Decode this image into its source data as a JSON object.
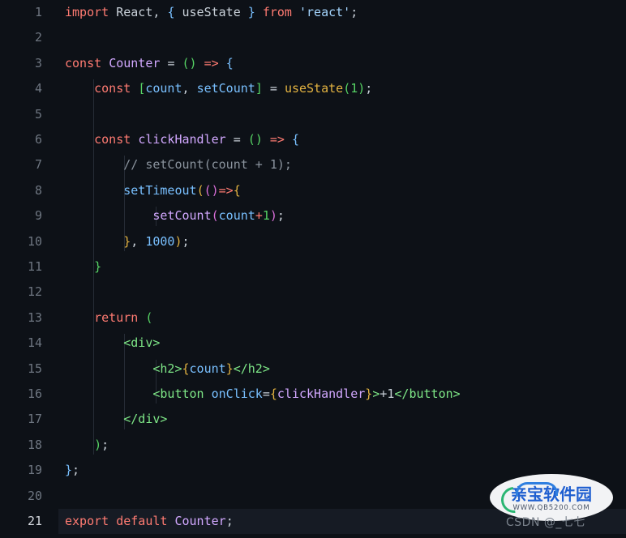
{
  "editor": {
    "theme": "dark-plus",
    "background": "#0d1117",
    "active_line_background": "#161b24",
    "gutter_color": "#6e7681",
    "active_gutter_color": "#d4d8de",
    "active_line": 21,
    "total_lines": 21,
    "language": "javascript-react"
  },
  "lines": [
    {
      "n": "1",
      "indent": 0,
      "tokens": [
        {
          "t": "import",
          "c": "kw"
        },
        {
          "t": " ",
          "c": "var"
        },
        {
          "t": "React",
          "c": "var"
        },
        {
          "t": ", ",
          "c": "var"
        },
        {
          "t": "{",
          "c": "b2"
        },
        {
          "t": " ",
          "c": "var"
        },
        {
          "t": "useState",
          "c": "var"
        },
        {
          "t": " ",
          "c": "var"
        },
        {
          "t": "}",
          "c": "b2"
        },
        {
          "t": " ",
          "c": "var"
        },
        {
          "t": "from",
          "c": "kw"
        },
        {
          "t": " ",
          "c": "var"
        },
        {
          "t": "'react'",
          "c": "str"
        },
        {
          "t": ";",
          "c": "var"
        }
      ]
    },
    {
      "n": "2",
      "indent": 0,
      "tokens": []
    },
    {
      "n": "3",
      "indent": 0,
      "tokens": [
        {
          "t": "const",
          "c": "kw"
        },
        {
          "t": " ",
          "c": "var"
        },
        {
          "t": "Counter",
          "c": "fn"
        },
        {
          "t": " ",
          "c": "var"
        },
        {
          "t": "=",
          "c": "var"
        },
        {
          "t": " ",
          "c": "var"
        },
        {
          "t": "(",
          "c": "b1"
        },
        {
          "t": ")",
          "c": "b1"
        },
        {
          "t": " ",
          "c": "var"
        },
        {
          "t": "=>",
          "c": "kw"
        },
        {
          "t": " ",
          "c": "var"
        },
        {
          "t": "{",
          "c": "b2"
        }
      ]
    },
    {
      "n": "4",
      "indent": 1,
      "tokens": [
        {
          "t": "    ",
          "c": "var"
        },
        {
          "t": "const",
          "c": "kw"
        },
        {
          "t": " ",
          "c": "var"
        },
        {
          "t": "[",
          "c": "b1"
        },
        {
          "t": "count",
          "c": "call"
        },
        {
          "t": ", ",
          "c": "var"
        },
        {
          "t": "setCount",
          "c": "call"
        },
        {
          "t": "]",
          "c": "b1"
        },
        {
          "t": " ",
          "c": "var"
        },
        {
          "t": "=",
          "c": "var"
        },
        {
          "t": " ",
          "c": "var"
        },
        {
          "t": "useState",
          "c": "yel"
        },
        {
          "t": "(",
          "c": "b1"
        },
        {
          "t": "1",
          "c": "num2"
        },
        {
          "t": ")",
          "c": "b1"
        },
        {
          "t": ";",
          "c": "var"
        }
      ]
    },
    {
      "n": "5",
      "indent": 1,
      "tokens": []
    },
    {
      "n": "6",
      "indent": 1,
      "tokens": [
        {
          "t": "    ",
          "c": "var"
        },
        {
          "t": "const",
          "c": "kw"
        },
        {
          "t": " ",
          "c": "var"
        },
        {
          "t": "clickHandler",
          "c": "fn"
        },
        {
          "t": " ",
          "c": "var"
        },
        {
          "t": "=",
          "c": "var"
        },
        {
          "t": " ",
          "c": "var"
        },
        {
          "t": "(",
          "c": "b1"
        },
        {
          "t": ")",
          "c": "b1"
        },
        {
          "t": " ",
          "c": "var"
        },
        {
          "t": "=>",
          "c": "kw"
        },
        {
          "t": " ",
          "c": "var"
        },
        {
          "t": "{",
          "c": "b2"
        }
      ]
    },
    {
      "n": "7",
      "indent": 2,
      "tokens": [
        {
          "t": "        ",
          "c": "var"
        },
        {
          "t": "// setCount(count + 1);",
          "c": "cmt"
        }
      ]
    },
    {
      "n": "8",
      "indent": 2,
      "tokens": [
        {
          "t": "        ",
          "c": "var"
        },
        {
          "t": "setTimeout",
          "c": "call"
        },
        {
          "t": "(",
          "c": "b3"
        },
        {
          "t": "(",
          "c": "b4"
        },
        {
          "t": ")",
          "c": "b4"
        },
        {
          "t": "=>",
          "c": "kw"
        },
        {
          "t": "{",
          "c": "b3"
        }
      ]
    },
    {
      "n": "9",
      "indent": 3,
      "tokens": [
        {
          "t": "            ",
          "c": "var"
        },
        {
          "t": "setCount",
          "c": "fn"
        },
        {
          "t": "(",
          "c": "b4"
        },
        {
          "t": "count",
          "c": "call"
        },
        {
          "t": "+",
          "c": "kw"
        },
        {
          "t": "1",
          "c": "num2"
        },
        {
          "t": ")",
          "c": "b4"
        },
        {
          "t": ";",
          "c": "var"
        }
      ]
    },
    {
      "n": "10",
      "indent": 2,
      "tokens": [
        {
          "t": "        ",
          "c": "var"
        },
        {
          "t": "}",
          "c": "b3"
        },
        {
          "t": ", ",
          "c": "var"
        },
        {
          "t": "1000",
          "c": "num"
        },
        {
          "t": ")",
          "c": "b3"
        },
        {
          "t": ";",
          "c": "var"
        }
      ]
    },
    {
      "n": "11",
      "indent": 1,
      "tokens": [
        {
          "t": "    ",
          "c": "var"
        },
        {
          "t": "}",
          "c": "b1"
        }
      ]
    },
    {
      "n": "12",
      "indent": 1,
      "tokens": []
    },
    {
      "n": "13",
      "indent": 1,
      "tokens": [
        {
          "t": "    ",
          "c": "var"
        },
        {
          "t": "return",
          "c": "kw"
        },
        {
          "t": " ",
          "c": "var"
        },
        {
          "t": "(",
          "c": "b1"
        }
      ]
    },
    {
      "n": "14",
      "indent": 2,
      "tokens": [
        {
          "t": "        ",
          "c": "var"
        },
        {
          "t": "<div>",
          "c": "tag"
        }
      ]
    },
    {
      "n": "15",
      "indent": 3,
      "tokens": [
        {
          "t": "            ",
          "c": "var"
        },
        {
          "t": "<h2>",
          "c": "tag"
        },
        {
          "t": "{",
          "c": "b3"
        },
        {
          "t": "count",
          "c": "call"
        },
        {
          "t": "}",
          "c": "b3"
        },
        {
          "t": "</h2>",
          "c": "tag"
        }
      ]
    },
    {
      "n": "16",
      "indent": 3,
      "tokens": [
        {
          "t": "            ",
          "c": "var"
        },
        {
          "t": "<button",
          "c": "tag"
        },
        {
          "t": " ",
          "c": "var"
        },
        {
          "t": "onClick",
          "c": "call"
        },
        {
          "t": "=",
          "c": "var"
        },
        {
          "t": "{",
          "c": "b3"
        },
        {
          "t": "clickHandler",
          "c": "fn"
        },
        {
          "t": "}",
          "c": "b3"
        },
        {
          "t": ">",
          "c": "tag"
        },
        {
          "t": "+1",
          "c": "var"
        },
        {
          "t": "</button>",
          "c": "tag"
        }
      ]
    },
    {
      "n": "17",
      "indent": 2,
      "tokens": [
        {
          "t": "        ",
          "c": "var"
        },
        {
          "t": "</div>",
          "c": "tag"
        }
      ]
    },
    {
      "n": "18",
      "indent": 1,
      "tokens": [
        {
          "t": "    ",
          "c": "var"
        },
        {
          "t": ")",
          "c": "b1"
        },
        {
          "t": ";",
          "c": "var"
        }
      ]
    },
    {
      "n": "19",
      "indent": 0,
      "tokens": [
        {
          "t": "}",
          "c": "b2"
        },
        {
          "t": ";",
          "c": "var"
        }
      ]
    },
    {
      "n": "20",
      "indent": 0,
      "tokens": []
    },
    {
      "n": "21",
      "indent": 0,
      "active": true,
      "tokens": [
        {
          "t": "export",
          "c": "kw"
        },
        {
          "t": " ",
          "c": "var"
        },
        {
          "t": "default",
          "c": "kw"
        },
        {
          "t": " ",
          "c": "var"
        },
        {
          "t": "Counter",
          "c": "fn"
        },
        {
          "t": ";",
          "c": "var"
        }
      ]
    }
  ],
  "watermark": {
    "logo_text": "亲宝软件园",
    "url_text": "WWW.QB5200.COM",
    "credit": "CSDN @_七七",
    "logo_color": "#1f5fd0",
    "accent_color": "#2bb673"
  }
}
